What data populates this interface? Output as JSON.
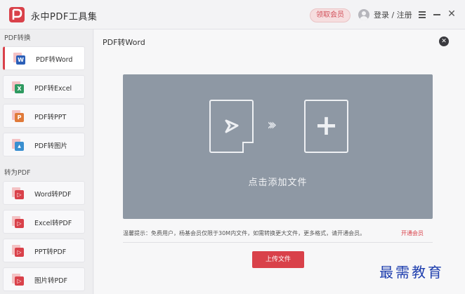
{
  "app": {
    "title": "永中PDF工具集",
    "vip_button": "领取会员",
    "login_text": "登录 / 注册",
    "accent_color": "#d9414a"
  },
  "window_controls": [
    {
      "name": "menu-icon"
    },
    {
      "name": "minimize-icon"
    },
    {
      "name": "close-icon",
      "glyph": "✕"
    }
  ],
  "sidebar": {
    "sections": [
      {
        "label": "PDF转换",
        "items": [
          {
            "label": "PDF转Word",
            "icon": "word-icon",
            "icon_glyph": "W",
            "color": "#2b5fb8",
            "active": true
          },
          {
            "label": "PDF转Excel",
            "icon": "excel-icon",
            "icon_glyph": "X",
            "color": "#2f9a61",
            "active": false
          },
          {
            "label": "PDF转PPT",
            "icon": "ppt-icon",
            "icon_glyph": "P",
            "color": "#e07a3a",
            "active": false
          },
          {
            "label": "PDF转图片",
            "icon": "image-icon",
            "icon_glyph": "▲",
            "color": "#3a8fd0",
            "active": false
          }
        ]
      },
      {
        "label": "转为PDF",
        "items": [
          {
            "label": "Word转PDF",
            "icon": "pdf-icon",
            "icon_glyph": "▷",
            "color": "#d9414a",
            "active": false
          },
          {
            "label": "Excel转PDF",
            "icon": "pdf-icon",
            "icon_glyph": "▷",
            "color": "#d9414a",
            "active": false
          },
          {
            "label": "PPT转PDF",
            "icon": "pdf-icon",
            "icon_glyph": "▷",
            "color": "#d9414a",
            "active": false
          },
          {
            "label": "图片转PDF",
            "icon": "pdf-icon",
            "icon_glyph": "▷",
            "color": "#d9414a",
            "active": false
          }
        ]
      }
    ]
  },
  "main": {
    "title": "PDF转Word",
    "close_glyph": "✕",
    "dropzone": {
      "text": "点击添加文件",
      "arrows": "›››",
      "plus": "+"
    },
    "notice": "温馨提示：免费用户，杨基会员仅限于30M内文件，如需转换更大文件，更多格式，请开通会员。",
    "notice_link": "开通会员",
    "upload_button": "上传文件"
  },
  "watermark": "最需教育"
}
